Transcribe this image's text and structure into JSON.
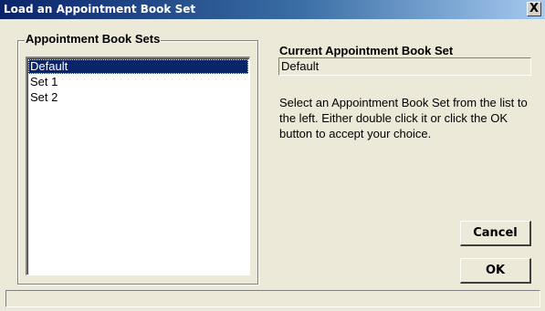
{
  "window": {
    "title": "Load an Appointment Book Set",
    "close_label": "X"
  },
  "sets_panel": {
    "label": "Appointment Book Sets",
    "items": [
      {
        "label": "Default",
        "selected": true
      },
      {
        "label": "Set 1",
        "selected": false
      },
      {
        "label": "Set 2",
        "selected": false
      }
    ]
  },
  "current": {
    "label": "Current Appointment Book Set",
    "value": "Default"
  },
  "instructions": "Select an Appointment Book Set  from the list to the left. Either double click it or click the OK button to accept your choice.",
  "buttons": {
    "cancel": "Cancel",
    "ok": "OK"
  },
  "status": {
    "text": ""
  }
}
